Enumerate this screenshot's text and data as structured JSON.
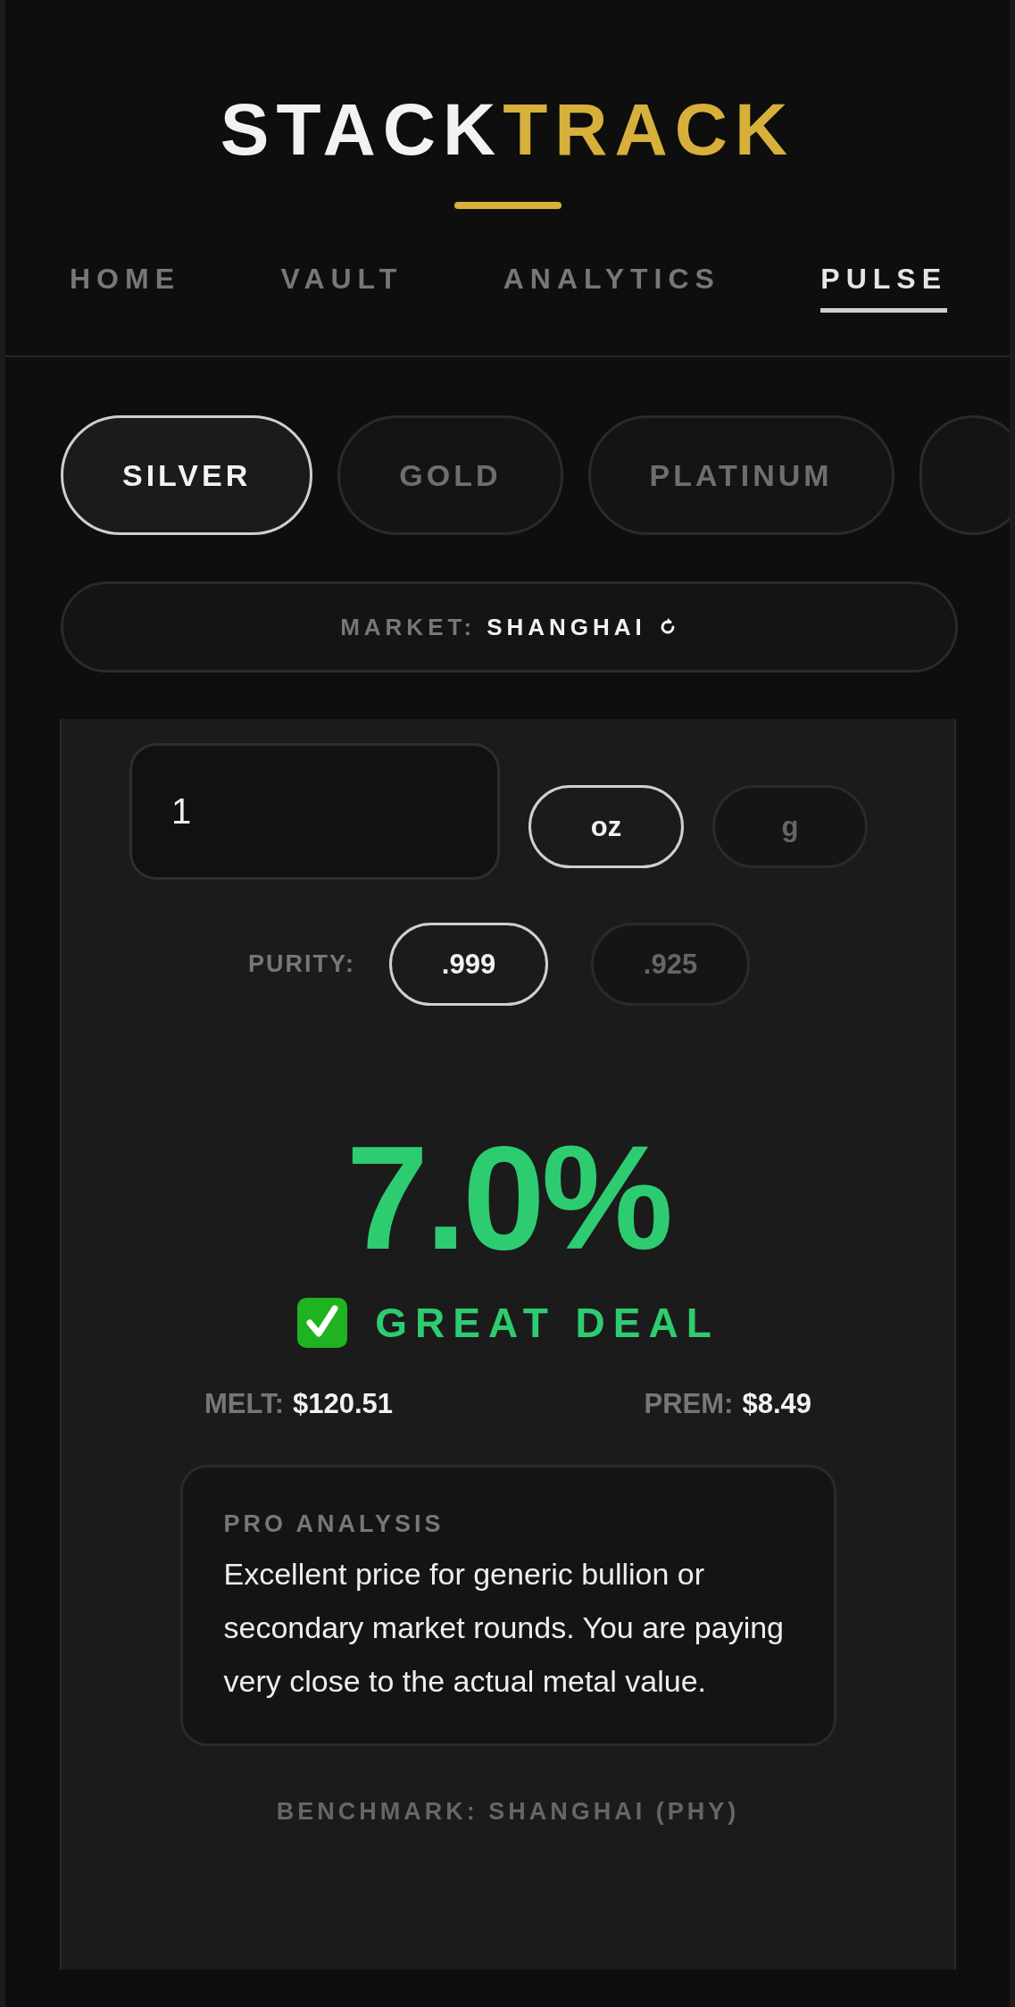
{
  "logo": {
    "primary": "STACK",
    "accent": "TRACK"
  },
  "nav": [
    {
      "label": "HOME",
      "selected": false
    },
    {
      "label": "VAULT",
      "selected": false
    },
    {
      "label": "ANALYTICS",
      "selected": false
    },
    {
      "label": "PULSE",
      "selected": true
    }
  ],
  "metals": [
    {
      "label": "SILVER",
      "selected": true
    },
    {
      "label": "GOLD",
      "selected": false
    },
    {
      "label": "PLATINUM",
      "selected": false
    }
  ],
  "market": {
    "label": "MARKET:",
    "value": "SHANGHAI"
  },
  "calculator": {
    "weight": {
      "value": "1"
    },
    "units": [
      {
        "label": "oz",
        "selected": true
      },
      {
        "label": "g",
        "selected": false
      }
    ],
    "purity": {
      "label": "PURITY:",
      "options": [
        {
          "label": ".999",
          "selected": true
        },
        {
          "label": ".925",
          "selected": false
        }
      ]
    }
  },
  "result": {
    "premium": "7.0%",
    "verdict": "GREAT DEAL",
    "melt_label": "MELT:",
    "melt": "$120.51",
    "prem_label": "PREM:",
    "prem": "$8.49"
  },
  "analysis": {
    "title": "PRO ANALYSIS",
    "text": "Excellent price for generic bullion or secondary market rounds. You are paying very close to the actual metal value."
  },
  "benchmark": "BENCHMARK: SHANGHAI (PHY)"
}
